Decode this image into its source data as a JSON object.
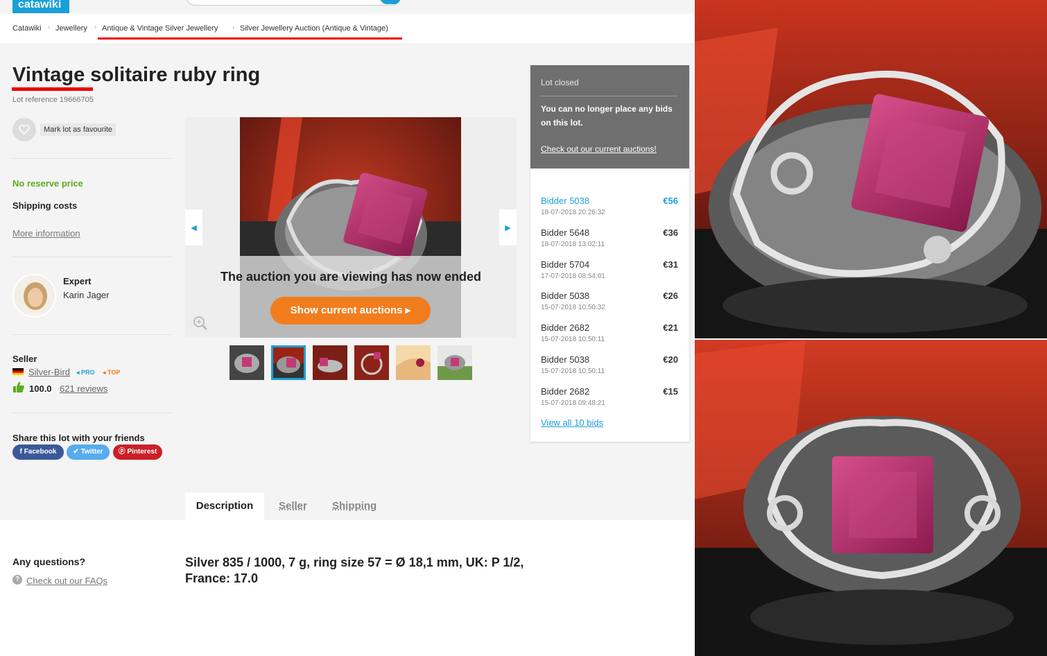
{
  "header": {
    "logo_text": "catawiki"
  },
  "breadcrumb": [
    "Catawiki",
    "Jewellery",
    "Antique & Vintage Silver Jewellery",
    "Silver Jewellery Auction (Antique & Vintage)"
  ],
  "lot": {
    "title_word_1": "Vintage",
    "title_rest": " solitaire ruby ring",
    "reference": "Lot reference 19666705",
    "favourite_label": "Mark lot as favourite",
    "no_reserve": "No reserve price",
    "shipping_label": "Shipping costs",
    "more_info": "More information"
  },
  "expert": {
    "label": "Expert",
    "name": "Karin Jager"
  },
  "seller": {
    "label": "Seller",
    "name": "Silver-Bird",
    "badge_pro": "◂ PRO",
    "badge_top": "◂ TOP",
    "score": "100.0",
    "reviews": "621 reviews"
  },
  "share": {
    "label": "Share this lot with your friends",
    "facebook": "f  Facebook",
    "twitter": "Twitter",
    "pinterest": "Pinterest"
  },
  "gallery": {
    "ended_message": "The auction you are viewing has now ended",
    "cta": "Show current auctions  ▸",
    "thumbnails_count": 6,
    "active_thumbnail": 2
  },
  "bids_panel": {
    "status": "Lot closed",
    "message": "You can no longer place any bids on this lot.",
    "link": "Check out our current auctions!",
    "bids": [
      {
        "bidder": "Bidder 5038",
        "date": "18-07-2018 20:26:32",
        "amount": "€56"
      },
      {
        "bidder": "Bidder 5648",
        "date": "18-07-2018 13:02:11",
        "amount": "€36"
      },
      {
        "bidder": "Bidder 5704",
        "date": "17-07-2018 08:54:01",
        "amount": "€31"
      },
      {
        "bidder": "Bidder 5038",
        "date": "15-07-2018 10:50:32",
        "amount": "€26"
      },
      {
        "bidder": "Bidder 2682",
        "date": "15-07-2018 10:50:11",
        "amount": "€21"
      },
      {
        "bidder": "Bidder 5038",
        "date": "15-07-2018 10:50:11",
        "amount": "€20"
      },
      {
        "bidder": "Bidder 2682",
        "date": "15-07-2018 09:48:21",
        "amount": "€15"
      }
    ],
    "view_all": "View all 10 bids"
  },
  "tabs": [
    "Description",
    "Seller",
    "Shipping"
  ],
  "content": {
    "questions_title": "Any questions?",
    "faq_link": "Check out our FAQs",
    "description": "Silver 835 / 1000, 7 g, ring size 57 = Ø 18,1 mm, UK: P 1/2, France: 17.0"
  },
  "colors": {
    "accent": "#1aa0d8",
    "cta_orange": "#f27d1e",
    "no_reserve_green": "#5cab1f",
    "annotation_red": "#ee0000"
  }
}
